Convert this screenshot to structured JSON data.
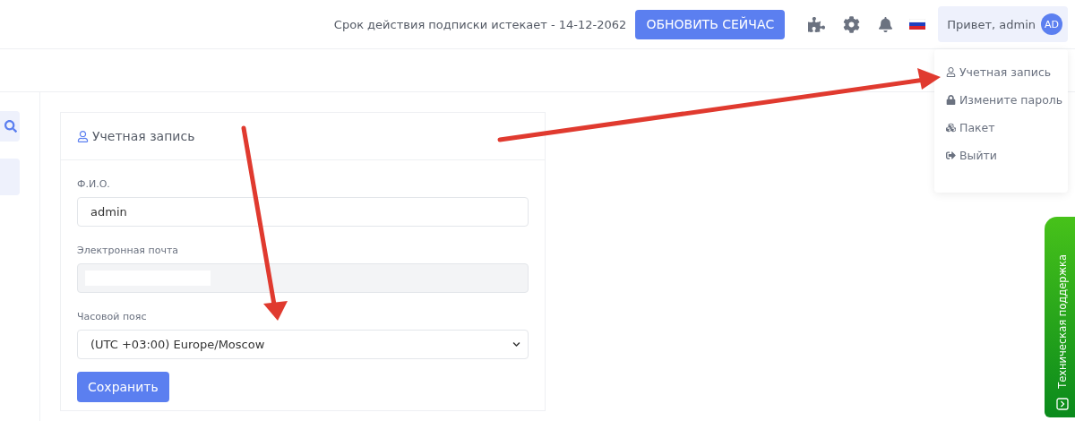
{
  "header": {
    "subscription_notice": "Срок действия подписки истекает - 14-12-2062",
    "upgrade_button": "ОБНОВИТЬ СЕЙЧАС",
    "greeting": "Привет, admin",
    "avatar_initials": "AD"
  },
  "user_menu": {
    "expanded": true,
    "items": [
      {
        "kind": "account",
        "label": "Учетная запись"
      },
      {
        "kind": "password",
        "label": "Измените пароль"
      },
      {
        "kind": "package",
        "label": "Пакет"
      },
      {
        "kind": "logout",
        "label": "Выйти"
      }
    ]
  },
  "card": {
    "title": "Учетная запись",
    "fields": [
      {
        "kind": "text",
        "label": "Ф.И.О.",
        "value": "admin",
        "disabled": false
      },
      {
        "kind": "redacted",
        "label": "Электронная почта",
        "disabled": true
      },
      {
        "kind": "select",
        "label": "Часовой пояс",
        "value": "(UTC +03:00) Europe/Moscow",
        "disabled": false
      }
    ],
    "save_button": "Сохранить"
  },
  "support_tab": {
    "label": "Техническая поддержка"
  }
}
